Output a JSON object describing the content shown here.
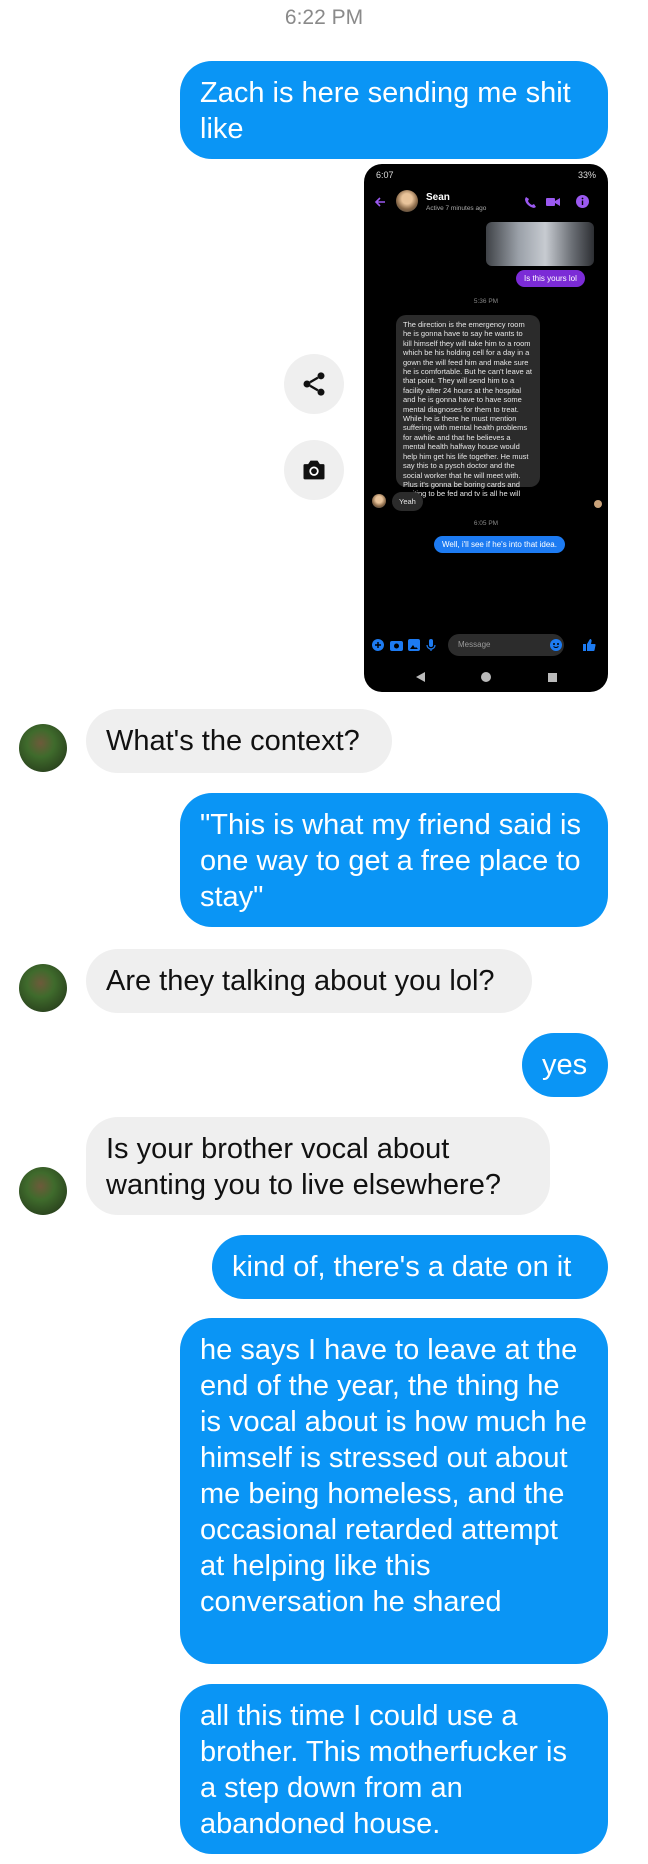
{
  "timestamp": "6:22 PM",
  "messages": [
    {
      "side": "sent",
      "text": "Zach is here sending me shit like"
    },
    {
      "side": "received",
      "text": "What's the context?"
    },
    {
      "side": "sent",
      "text": "\"This is what my friend said is one way to get a free place to stay\""
    },
    {
      "side": "received",
      "text": "Are they talking about you lol?"
    },
    {
      "side": "sent",
      "text": "yes"
    },
    {
      "side": "received",
      "text": "Is your brother vocal about wanting you to live elsewhere?"
    },
    {
      "side": "sent",
      "text": "kind of, there's a date on it"
    },
    {
      "side": "sent",
      "text": "he says I have to leave at the end of the year, the thing he is vocal about is how much he himself is stressed out about me being homeless, and the occasional retarded attempt at helping like this conversation he shared"
    },
    {
      "side": "sent",
      "text": "all this time I could use a brother. This motherfucker is a step down from an abandoned house."
    }
  ],
  "screenshot": {
    "status_time": "6:07",
    "battery": "33%",
    "contact_name": "Sean",
    "contact_status": "Active 7 minutes ago",
    "bubble_1": "Is this yours lol",
    "time_1": "5:36 PM",
    "long_message": "The direction is the emergency room he is gonna have to say he wants to kill himself they will take him to a room which be his holding cell for a day in a gown the will feed him and make sure he is comfortable. But he can't leave at that point. They will send him to a facility after 24 hours at the hospital and he is gonna have to have some mental diagnoses for them to treat. While he is there he must mention suffering with mental health problems for awhile and that he believes a mental health halfway house would help him get his life together. He must say this to a pysch doctor and the social worker that he will meet with. Plus it's gonna be boring cards and waiting to be fed and tv is all he will have.",
    "reply_yeah": "Yeah",
    "time_2": "6:05 PM",
    "bubble_2": "Well, i'll see if he's into that idea.",
    "input_placeholder": "Message"
  },
  "icons": {
    "share": "share-icon",
    "camera": "camera-icon"
  },
  "colors": {
    "sent_bubble": "#0a95f5",
    "received_bubble": "#efefef",
    "messenger_purple": "#7b2bd6"
  }
}
